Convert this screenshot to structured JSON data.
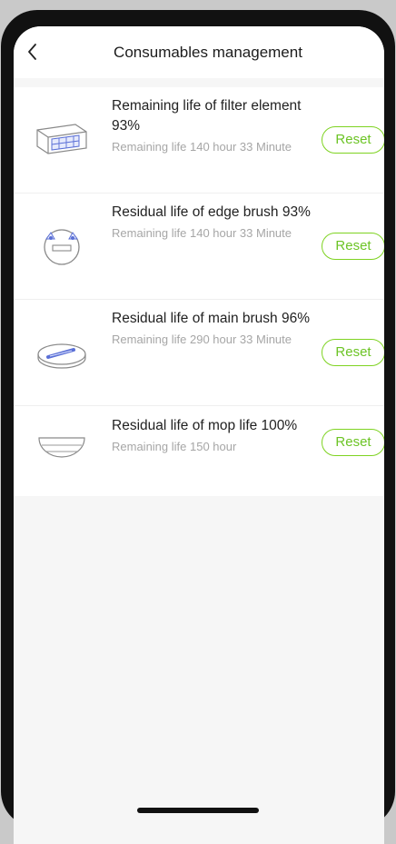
{
  "header": {
    "title": "Consumables management",
    "back_icon": "chevron-left-icon"
  },
  "consumables": [
    {
      "title": "Remaining life of filter element 93%",
      "subtitle": "Remaining life 140 hour 33 Minute",
      "button": "Reset",
      "icon": "filter-element-icon",
      "percent": 93
    },
    {
      "title": "Residual life of edge brush 93%",
      "subtitle": "Remaining life 140 hour 33 Minute",
      "button": "Reset",
      "icon": "edge-brush-icon",
      "percent": 93
    },
    {
      "title": "Residual life of main brush 96%",
      "subtitle": "Remaining life 290 hour 33 Minute",
      "button": "Reset",
      "icon": "main-brush-icon",
      "percent": 96
    },
    {
      "title": "Residual life of mop life 100%",
      "subtitle": "Remaining life 150 hour",
      "button": "Reset",
      "icon": "mop-icon",
      "percent": 100
    }
  ],
  "colors": {
    "accent": "#7ed321",
    "background": "#f6f6f6",
    "secondary_text": "#a6a6a6"
  }
}
